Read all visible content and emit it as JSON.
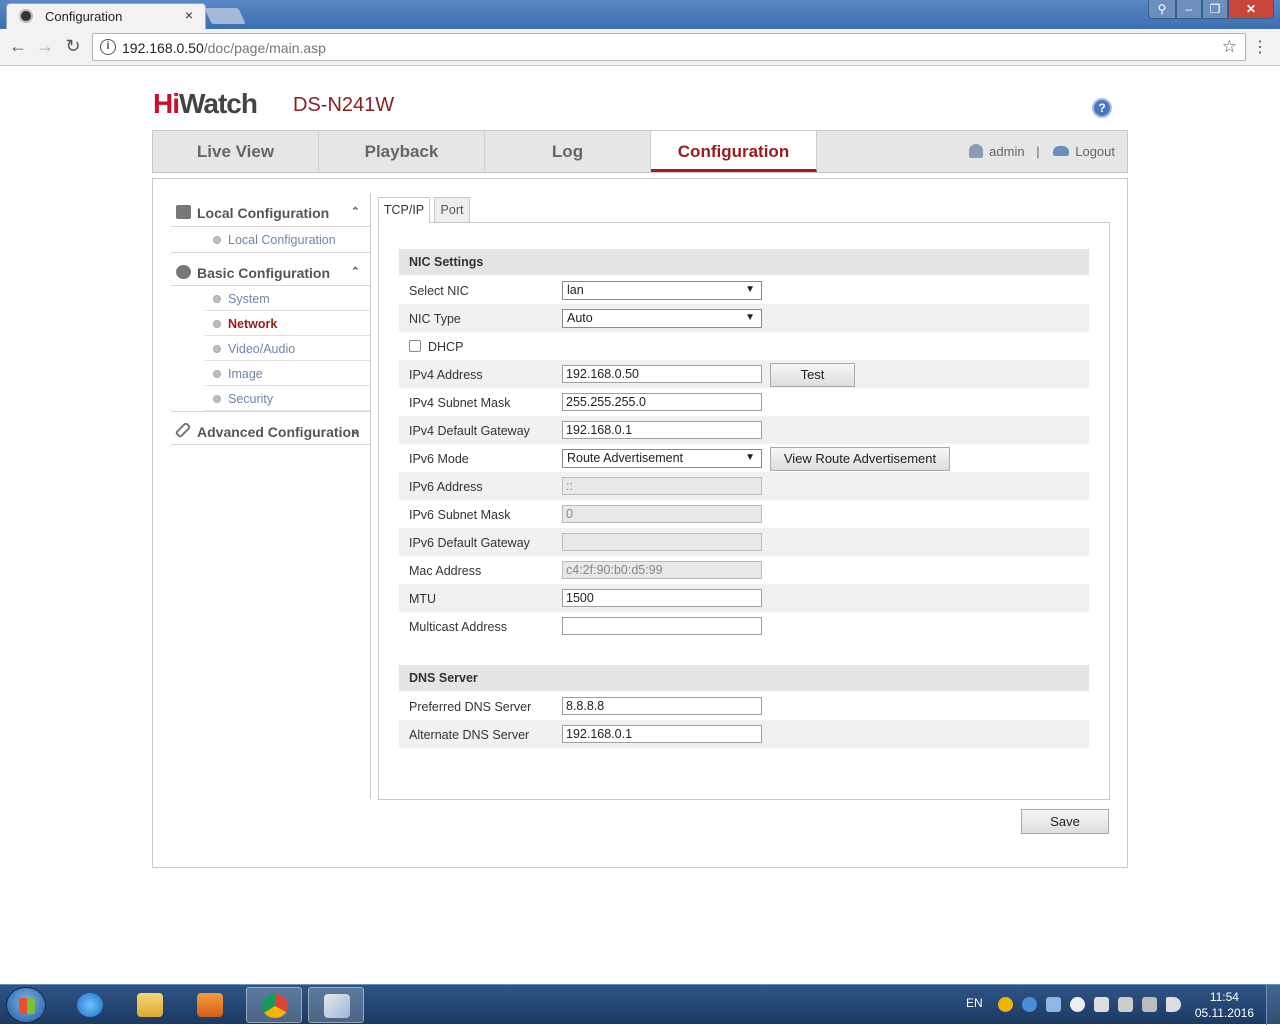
{
  "browser": {
    "tab_title": "Configuration",
    "tab_close": "×",
    "url_host": "192.168.0.50",
    "url_path": "/doc/page/main.asp",
    "back": "←",
    "forward": "→",
    "reload": "↻",
    "star": "☆",
    "menu": "⋮",
    "win_close": "✕",
    "win_min": "–",
    "win_max": "❐",
    "win_user": "⚲"
  },
  "app": {
    "logo_hi": "Hi",
    "logo_watch": "Watch",
    "model": "DS-N241W",
    "help": "?"
  },
  "nav": {
    "tabs": [
      {
        "label": "Live View"
      },
      {
        "label": "Playback"
      },
      {
        "label": "Log"
      },
      {
        "label": "Configuration"
      }
    ],
    "user": "admin",
    "separator": "|",
    "logout": "Logout"
  },
  "sidebar": {
    "local": {
      "label": "Local Configuration",
      "chevron": "⌃",
      "items": [
        {
          "label": "Local Configuration"
        }
      ]
    },
    "basic": {
      "label": "Basic Configuration",
      "chevron": "⌃",
      "items": [
        {
          "label": "System"
        },
        {
          "label": "Network"
        },
        {
          "label": "Video/Audio"
        },
        {
          "label": "Image"
        },
        {
          "label": "Security"
        }
      ]
    },
    "advanced": {
      "label": "Advanced Configuration",
      "chevron": "⌄"
    }
  },
  "subtabs": [
    {
      "label": "TCP/IP"
    },
    {
      "label": "Port"
    }
  ],
  "nic": {
    "heading": "NIC Settings",
    "select_nic_label": "Select NIC",
    "select_nic_value": "lan",
    "nic_type_label": "NIC Type",
    "nic_type_value": "Auto",
    "dhcp_label": "DHCP",
    "ipv4_address_label": "IPv4 Address",
    "ipv4_address_value": "192.168.0.50",
    "test_label": "Test",
    "ipv4_mask_label": "IPv4 Subnet Mask",
    "ipv4_mask_value": "255.255.255.0",
    "ipv4_gateway_label": "IPv4 Default Gateway",
    "ipv4_gateway_value": "192.168.0.1",
    "ipv6_mode_label": "IPv6 Mode",
    "ipv6_mode_value": "Route Advertisement",
    "view_route_label": "View Route Advertisement",
    "ipv6_address_label": "IPv6 Address",
    "ipv6_address_value": "::",
    "ipv6_mask_label": "IPv6 Subnet Mask",
    "ipv6_mask_value": "0",
    "ipv6_gateway_label": "IPv6 Default Gateway",
    "ipv6_gateway_value": "",
    "mac_label": "Mac Address",
    "mac_value": "c4:2f:90:b0:d5:99",
    "mtu_label": "MTU",
    "mtu_value": "1500",
    "multicast_label": "Multicast Address",
    "multicast_value": "",
    "select_arrow": "▼"
  },
  "dns": {
    "heading": "DNS Server",
    "preferred_label": "Preferred DNS Server",
    "preferred_value": "8.8.8.8",
    "alternate_label": "Alternate DNS Server",
    "alternate_value": "192.168.0.1"
  },
  "save_label": "Save",
  "taskbar": {
    "lang": "EN",
    "time": "11:54",
    "date": "05.11.2016"
  },
  "colors": {
    "accent": "#9a1b1b",
    "logo_red": "#c8102e",
    "link_blue": "#6f86a8"
  }
}
